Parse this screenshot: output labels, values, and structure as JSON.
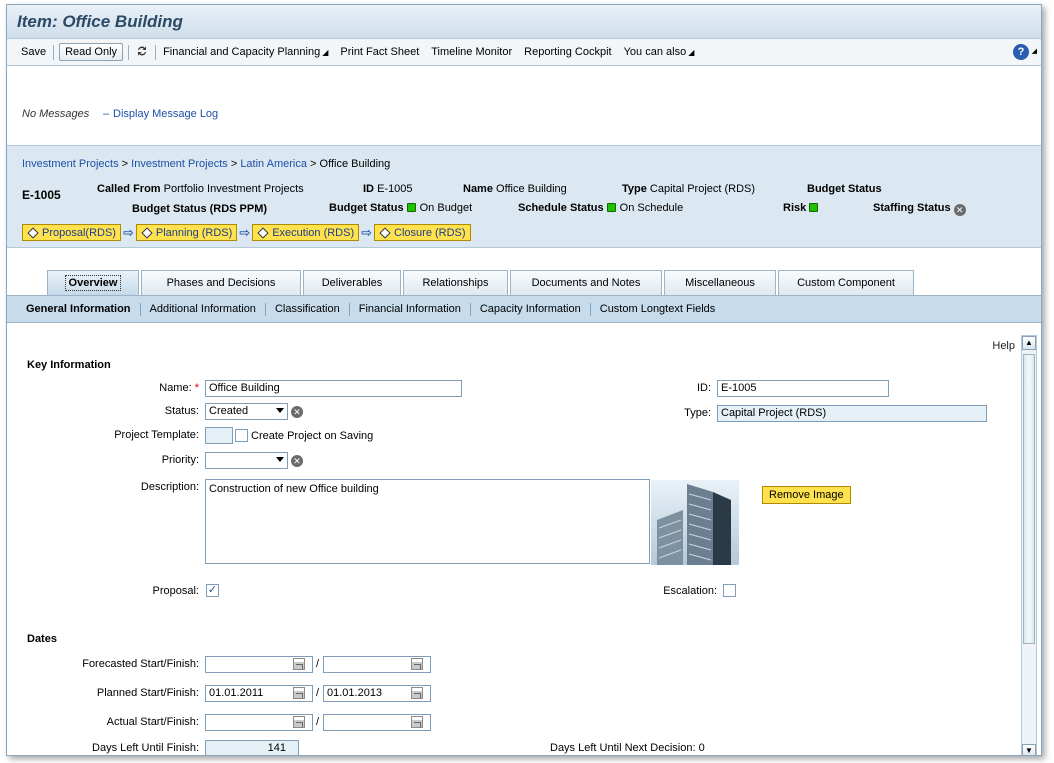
{
  "window": {
    "title": "Item: Office Building"
  },
  "toolbar": {
    "save": "Save",
    "read_only": "Read Only",
    "financial": "Financial and Capacity Planning",
    "print": "Print Fact Sheet",
    "timeline": "Timeline Monitor",
    "reporting": "Reporting Cockpit",
    "you_can_also": "You can also",
    "help": "?"
  },
  "messages": {
    "none": "No Messages",
    "dash": "–",
    "display_log": "Display Message Log"
  },
  "breadcrumb": {
    "items": [
      "Investment Projects",
      "Investment Projects",
      "Latin America"
    ],
    "current": "Office Building",
    "sep": ">"
  },
  "header": {
    "item_id": "E-1005",
    "called_from_label": "Called From",
    "called_from_value": "Portfolio Investment Projects",
    "id_label": "ID",
    "id_value": "E-1005",
    "name_label": "Name",
    "name_value": "Office Building",
    "type_label": "Type",
    "type_value": "Capital Project (RDS)",
    "budget_status_label": "Budget Status",
    "budget_status_rds_label": "Budget Status (RDS PPM)",
    "budget_status_label2": "Budget Status",
    "budget_status_value": "On Budget",
    "schedule_status_label": "Schedule Status",
    "schedule_status_value": "On Schedule",
    "risk_label": "Risk",
    "staffing_status_label": "Staffing Status"
  },
  "phases": [
    "Proposal(RDS)",
    "Planning (RDS)",
    "Execution (RDS)",
    "Closure (RDS)"
  ],
  "tabs": [
    "Overview",
    "Phases and Decisions",
    "Deliverables",
    "Relationships",
    "Documents and Notes",
    "Miscellaneous",
    "Custom Component"
  ],
  "subtabs": [
    "General Information",
    "Additional Information",
    "Classification",
    "Financial Information",
    "Capacity Information",
    "Custom Longtext Fields"
  ],
  "content": {
    "help": "Help",
    "key_info_title": "Key Information",
    "name_label": "Name:",
    "name_required": "*",
    "name_value": "Office Building",
    "status_label": "Status:",
    "status_value": "Created",
    "template_label": "Project Template:",
    "create_on_saving": "Create Project on Saving",
    "priority_label": "Priority:",
    "priority_value": "",
    "description_label": "Description:",
    "description_value": "Construction of new Office building",
    "remove_image": "Remove Image",
    "proposal_label": "Proposal:",
    "proposal_checked": "✓",
    "escalation_label": "Escalation:",
    "id_label": "ID:",
    "id_value": "E-1005",
    "type_label": "Type:",
    "type_value": "Capital Project (RDS)",
    "dates_title": "Dates",
    "forecasted_label": "Forecasted Start/Finish:",
    "planned_label": "Planned Start/Finish:",
    "planned_start": "01.01.2011",
    "planned_finish": "01.01.2013",
    "actual_label": "Actual Start/Finish:",
    "slash": "/",
    "days_left_label": "Days Left Until Finish:",
    "days_left_value": "141",
    "days_next_label": "Days Left Until Next Decision:",
    "days_next_value": "0"
  }
}
